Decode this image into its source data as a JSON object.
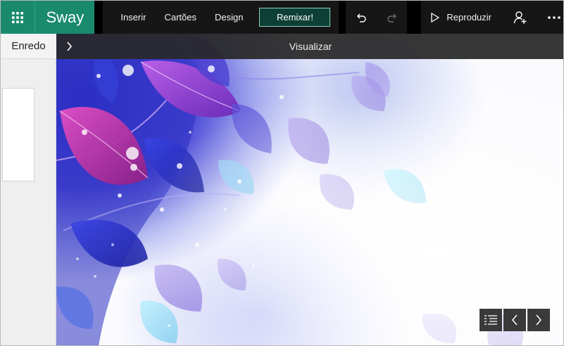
{
  "app": {
    "brand": "Sway"
  },
  "toolbar": {
    "items": [
      "Inserir",
      "Cartões",
      "Design"
    ],
    "remix_label": "Remixar!",
    "play_label": "Reproduzir"
  },
  "storyline": {
    "label": "Enredo"
  },
  "preview": {
    "title": "Visualizar"
  },
  "icons": {
    "apps": "waffle-icon",
    "undo": "undo-icon",
    "redo": "redo-icon",
    "play": "play-icon",
    "share": "add-person-icon",
    "more": "more-icon",
    "expand": "chevron-right-icon",
    "navigation": "navigation-list-icon",
    "previous": "chevron-left-icon",
    "next": "chevron-right-icon"
  },
  "colors": {
    "brand": "#1a8a6d",
    "topbar": "#000000",
    "remix_bg": "#0d3f35",
    "remix_border": "#8ad0bf"
  }
}
